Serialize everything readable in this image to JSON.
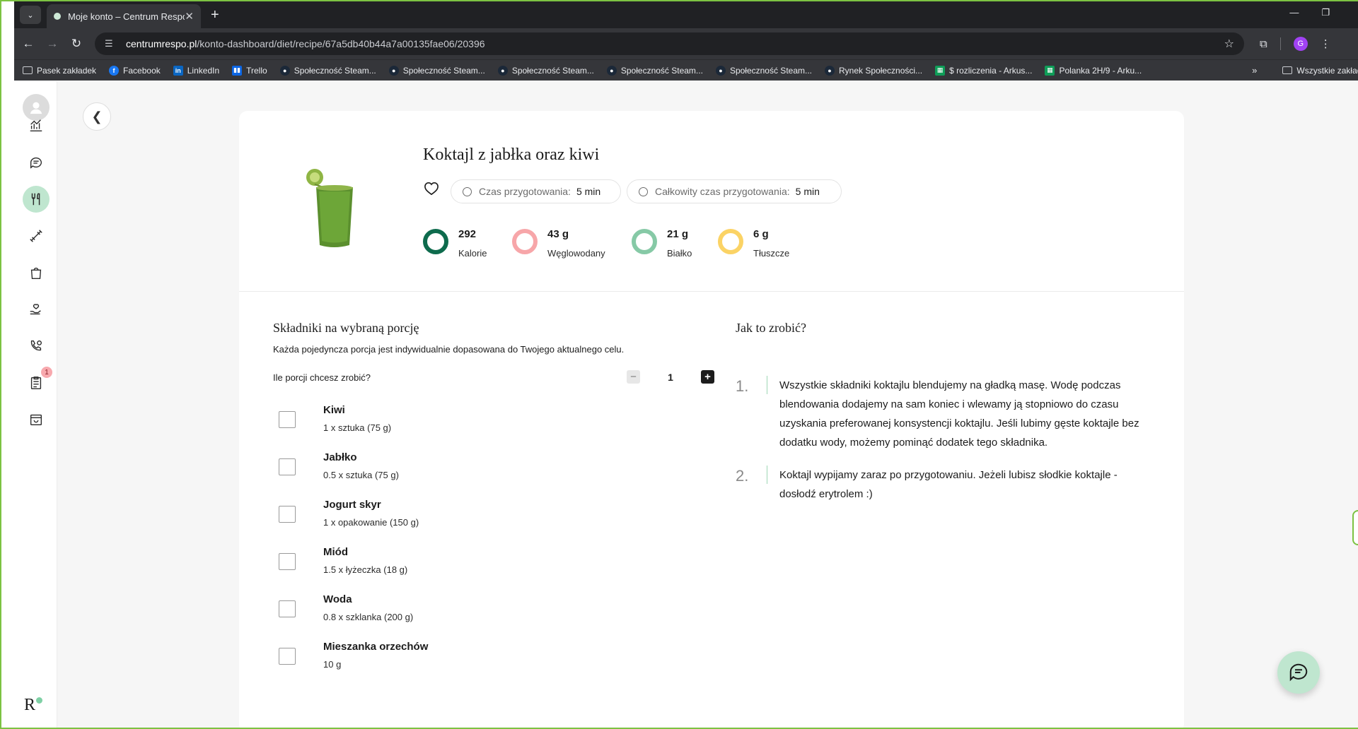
{
  "browser": {
    "tab_title": "Moje konto – Centrum Respo",
    "new_tab": "+",
    "url_host": "centrumrespo.pl",
    "url_path": "/konto-dashboard/diet/recipe/67a5db40b44a7a00135fae06/20396",
    "profile_initial": "G",
    "bookmarks": [
      {
        "label": "Pasek zakładek",
        "icon": "folder-icon"
      },
      {
        "label": "Facebook",
        "icon": "facebook-icon"
      },
      {
        "label": "LinkedIn",
        "icon": "linkedin-icon"
      },
      {
        "label": "Trello",
        "icon": "trello-icon"
      },
      {
        "label": "Społeczność Steam...",
        "icon": "steam-icon"
      },
      {
        "label": "Społeczność Steam...",
        "icon": "steam-icon"
      },
      {
        "label": "Społeczność Steam...",
        "icon": "steam-icon"
      },
      {
        "label": "Społeczność Steam...",
        "icon": "steam-icon"
      },
      {
        "label": "Społeczność Steam...",
        "icon": "steam-icon"
      },
      {
        "label": "Rynek Społeczności...",
        "icon": "steam-icon"
      },
      {
        "label": "$ rozliczenia - Arkus...",
        "icon": "sheets-icon"
      },
      {
        "label": "Polanka 2H/9 - Arku...",
        "icon": "sheets-icon"
      }
    ],
    "bookmarks_more": "»",
    "all_bookmarks": "Wszystkie zakładki"
  },
  "sidebar": {
    "badge_count": "1",
    "logo": "R"
  },
  "recipe": {
    "title": "Koktajl z jabłka oraz kiwi",
    "prep_label": "Czas przygotowania:",
    "prep_value": "5 min",
    "total_label": "Całkowity czas przygotowania:",
    "total_value": "5 min",
    "macros": [
      {
        "value": "292",
        "label": "Kalorie",
        "color": "#0e6b4d"
      },
      {
        "value": "43 g",
        "label": "Węglowodany",
        "color": "#f7a6a9"
      },
      {
        "value": "21 g",
        "label": "Białko",
        "color": "#86c9a6"
      },
      {
        "value": "6 g",
        "label": "Tłuszcze",
        "color": "#fbd365"
      }
    ]
  },
  "ingredients": {
    "heading": "Składniki na wybraną porcję",
    "subtitle": "Każda pojedyncza porcja jest indywidualnie dopasowana do Twojego aktualnego celu.",
    "portions_label": "Ile porcji chcesz zrobić?",
    "portions_value": "1",
    "minus": "−",
    "plus": "+",
    "items": [
      {
        "name": "Kiwi",
        "qty": "1 x sztuka (75 g)"
      },
      {
        "name": "Jabłko",
        "qty": "0.5 x sztuka (75 g)"
      },
      {
        "name": "Jogurt skyr",
        "qty": "1 x opakowanie (150 g)"
      },
      {
        "name": "Miód",
        "qty": "1.5 x łyżeczka (18 g)"
      },
      {
        "name": "Woda",
        "qty": "0.8 x szklanka (200 g)"
      },
      {
        "name": "Mieszanka orzechów",
        "qty": "10 g"
      }
    ]
  },
  "howto": {
    "heading": "Jak to zrobić?",
    "steps": [
      {
        "num": "1.",
        "text": "Wszystkie składniki koktajlu blendujemy na gładką masę. Wodę podczas blendowania dodajemy na sam koniec i wlewamy ją stopniowo do czasu uzyskania preferowanej konsystencji koktajlu. Jeśli lubimy gęste koktajle bez dodatku wody, możemy pominąć dodatek tego składnika."
      },
      {
        "num": "2.",
        "text": "Koktajl wypijamy zaraz po przygotowaniu. Jeżeli lubisz słodkie koktajle - dosłodź erytrolem :)"
      }
    ]
  },
  "colors": {
    "accent_green": "#bfe6cf",
    "frame_green": "#7cc242"
  }
}
